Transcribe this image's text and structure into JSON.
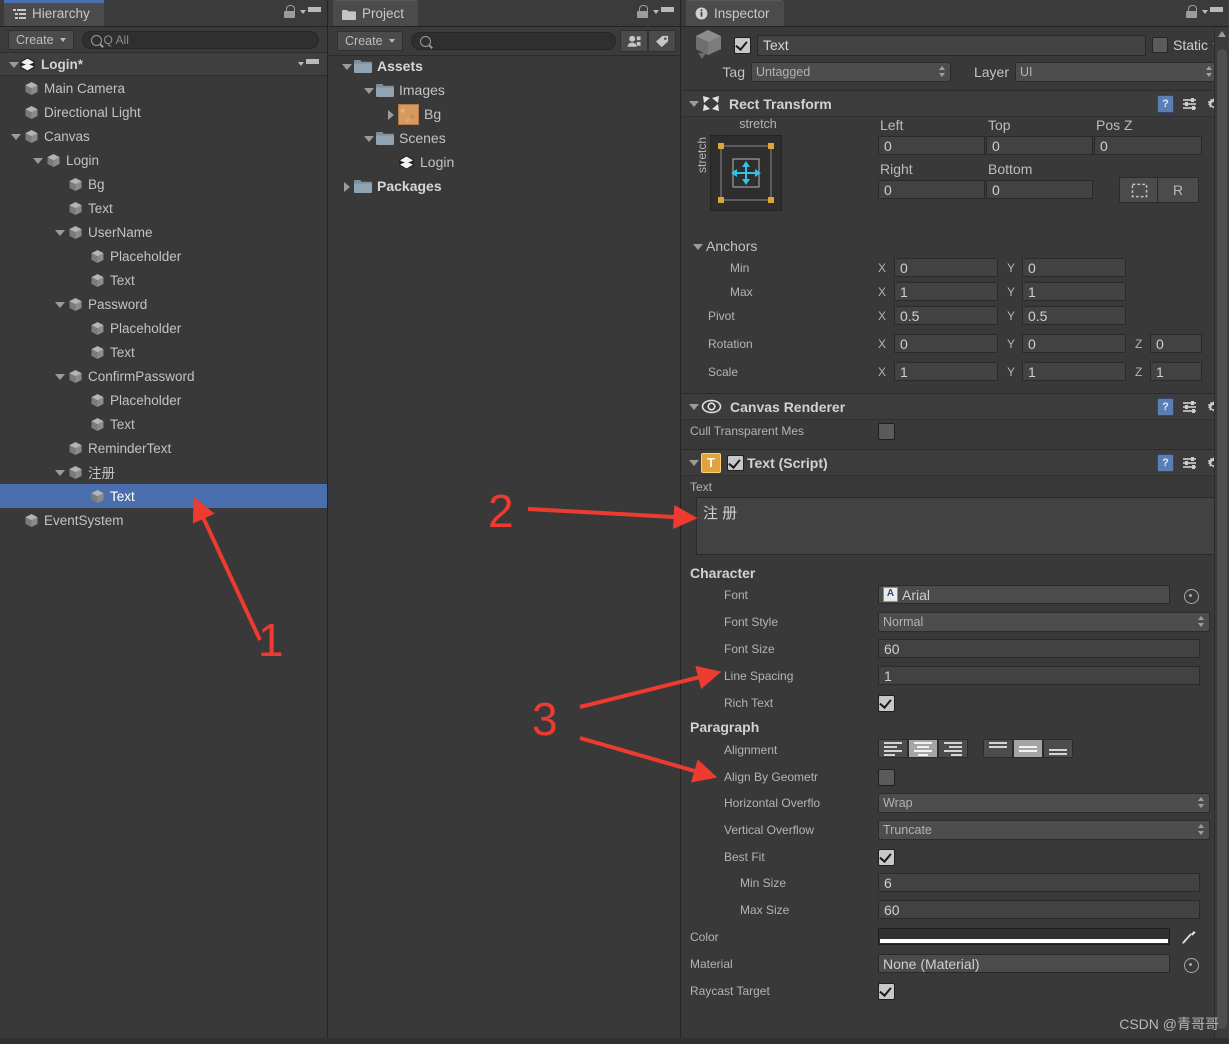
{
  "hierarchy": {
    "tab_label": "Hierarchy",
    "tab_icon": "hierarchy-icon",
    "create_label": "Create",
    "search_placeholder": "Q All",
    "search_value": "",
    "scene_name": "Login*",
    "items": [
      {
        "label": "Main Camera",
        "depth": 1,
        "arrow": "none",
        "selected": false
      },
      {
        "label": "Directional Light",
        "depth": 1,
        "arrow": "none",
        "selected": false
      },
      {
        "label": "Canvas",
        "depth": 1,
        "arrow": "open",
        "selected": false
      },
      {
        "label": "Login",
        "depth": 2,
        "arrow": "open",
        "selected": false
      },
      {
        "label": "Bg",
        "depth": 3,
        "arrow": "none",
        "selected": false
      },
      {
        "label": "Text",
        "depth": 3,
        "arrow": "none",
        "selected": false
      },
      {
        "label": "UserName",
        "depth": 3,
        "arrow": "open",
        "selected": false
      },
      {
        "label": "Placeholder",
        "depth": 4,
        "arrow": "none",
        "selected": false
      },
      {
        "label": "Text",
        "depth": 4,
        "arrow": "none",
        "selected": false
      },
      {
        "label": "Password",
        "depth": 3,
        "arrow": "open",
        "selected": false
      },
      {
        "label": "Placeholder",
        "depth": 4,
        "arrow": "none",
        "selected": false
      },
      {
        "label": "Text",
        "depth": 4,
        "arrow": "none",
        "selected": false
      },
      {
        "label": "ConfirmPassword",
        "depth": 3,
        "arrow": "open",
        "selected": false
      },
      {
        "label": "Placeholder",
        "depth": 4,
        "arrow": "none",
        "selected": false
      },
      {
        "label": "Text",
        "depth": 4,
        "arrow": "none",
        "selected": false
      },
      {
        "label": "ReminderText",
        "depth": 3,
        "arrow": "none",
        "selected": false
      },
      {
        "label": "注册",
        "depth": 3,
        "arrow": "open",
        "selected": false
      },
      {
        "label": "Text",
        "depth": 4,
        "arrow": "none",
        "selected": true
      },
      {
        "label": "EventSystem",
        "depth": 1,
        "arrow": "none",
        "selected": false
      }
    ]
  },
  "project": {
    "tab_label": "Project",
    "tab_icon": "folder-icon",
    "create_label": "Create",
    "search_placeholder": "",
    "search_value": "",
    "items": [
      {
        "label": "Assets",
        "depth": 0,
        "arrow": "open",
        "icon": "folder",
        "bold": true
      },
      {
        "label": "Images",
        "depth": 1,
        "arrow": "open",
        "icon": "folder",
        "bold": false
      },
      {
        "label": "Bg",
        "depth": 2,
        "arrow": "closed",
        "icon": "texture",
        "bold": false
      },
      {
        "label": "Scenes",
        "depth": 1,
        "arrow": "open",
        "icon": "folder",
        "bold": false
      },
      {
        "label": "Login",
        "depth": 2,
        "arrow": "none",
        "icon": "unity",
        "bold": false
      },
      {
        "label": "Packages",
        "depth": 0,
        "arrow": "closed",
        "icon": "folder",
        "bold": true
      }
    ]
  },
  "inspector": {
    "tab_label": "Inspector",
    "tab_icon": "info-icon",
    "object": {
      "enabled": true,
      "name": "Text",
      "static_label": "Static",
      "static_checked": false,
      "tag_label": "Tag",
      "tag_value": "Untagged",
      "layer_label": "Layer",
      "layer_value": "UI"
    },
    "rect_transform": {
      "title": "Rect Transform",
      "anchor_preset_label": "stretch",
      "anchor_preset_label_vertical": "stretch",
      "left_label": "Left",
      "left_value": "0",
      "top_label": "Top",
      "top_value": "0",
      "posz_label": "Pos Z",
      "posz_value": "0",
      "right_label": "Right",
      "right_value": "0",
      "bottom_label": "Bottom",
      "bottom_value": "0",
      "blueprint_button": "blueprint-mode",
      "raw_button": "R",
      "anchors_label": "Anchors",
      "min_label": "Min",
      "min_x": "0",
      "min_y": "0",
      "max_label": "Max",
      "max_x": "1",
      "max_y": "1",
      "pivot_label": "Pivot",
      "pivot_x": "0.5",
      "pivot_y": "0.5",
      "rotation_label": "Rotation",
      "rot_x": "0",
      "rot_y": "0",
      "rot_z": "0",
      "scale_label": "Scale",
      "scale_x": "1",
      "scale_y": "1",
      "scale_z": "1",
      "axis_x": "X",
      "axis_y": "Y",
      "axis_z": "Z"
    },
    "canvas_renderer": {
      "title": "Canvas Renderer",
      "cull_label": "Cull Transparent Mes",
      "cull_checked": false
    },
    "text_script": {
      "title": "Text (Script)",
      "enabled": true,
      "text_label": "Text",
      "text_value": "注 册",
      "character_header": "Character",
      "font_label": "Font",
      "font_value": "Arial",
      "font_style_label": "Font Style",
      "font_style_value": "Normal",
      "font_size_label": "Font Size",
      "font_size_value": "60",
      "line_spacing_label": "Line Spacing",
      "line_spacing_value": "1",
      "rich_text_label": "Rich Text",
      "rich_text_checked": true,
      "paragraph_header": "Paragraph",
      "alignment_label": "Alignment",
      "alignment_horizontal": "center",
      "alignment_vertical": "middle",
      "align_geometry_label": "Align By Geometr",
      "align_geometry_checked": false,
      "h_overflow_label": "Horizontal Overflo",
      "h_overflow_value": "Wrap",
      "v_overflow_label": "Vertical Overflow",
      "v_overflow_value": "Truncate",
      "best_fit_label": "Best Fit",
      "best_fit_checked": true,
      "min_size_label": "Min Size",
      "min_size_value": "6",
      "max_size_label": "Max Size",
      "max_size_value": "60",
      "color_label": "Color",
      "color_value": "#FFFFFF",
      "material_label": "Material",
      "material_value": "None (Material)",
      "raycast_label": "Raycast Target",
      "raycast_checked": true
    }
  },
  "annotations": {
    "marker1": "1",
    "marker2": "2",
    "marker3": "3",
    "arrow_color": "#ee3b2f"
  },
  "watermark": "CSDN @青哥哥",
  "theme": {
    "selection_blue": "#4b6eaf",
    "panel_bg": "#393939",
    "field_bg": "#424242",
    "text": "#c3c3c3"
  }
}
